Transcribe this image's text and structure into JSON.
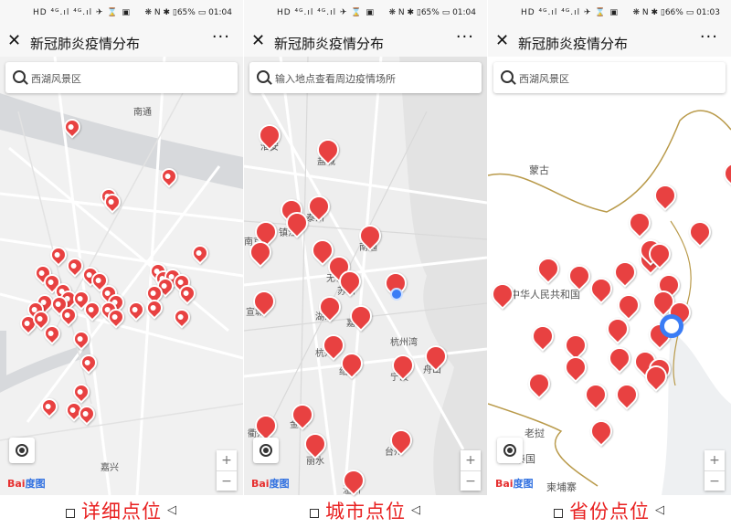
{
  "panels": [
    {
      "status_left": "HD ⁣⁴ᴳ.ıl ⁴ᴳ.ıl ✈ ⌛ ▣",
      "status_right": "❋ N ✱ ▯65% ▭ 01:04",
      "title": "新冠肺炎疫情分布",
      "search_placeholder": "西湖风景区",
      "caption": "详细点位",
      "labels": [
        "南通",
        "嘉兴"
      ]
    },
    {
      "status_left": "HD ⁴ᴳ.ıl ⁴ᴳ.ıl ✈ ⌛ ▣",
      "status_right": "❋ N ✱ ▯65% ▭ 01:04",
      "title": "新冠肺炎疫情分布",
      "search_placeholder": "输入地点查看周边疫情场所",
      "caption": "城市点位",
      "labels": [
        "淮安",
        "盐城",
        "镇江",
        "泰州",
        "南京",
        "南通",
        "无锡",
        "苏州",
        "宣城",
        "湖州",
        "嘉兴",
        "杭州湾",
        "杭州",
        "绍兴",
        "宁波",
        "舟山",
        "金华",
        "衢州",
        "丽水",
        "台州",
        "温州"
      ]
    },
    {
      "status_left": "HD ⁴ᴳ.ıl ⁴ᴳ.ıl ✈ ⌛ ▣",
      "status_right": "❋ N ✱ ▯66% ▭ 01:03",
      "title": "新冠肺炎疫情分布",
      "search_placeholder": "西湖风景区",
      "caption": "省份点位",
      "labels": [
        "蒙古",
        "中华人民共和国",
        "老挝",
        "泰国",
        "柬埔寨"
      ]
    }
  ],
  "brand": {
    "bai": "Bai",
    "du": "度图"
  },
  "colors": {
    "pin": "#e84141",
    "caption": "#e82020",
    "location": "#3a7cf5"
  },
  "icons": {
    "close": "close-icon",
    "more": "more-icon",
    "search": "search-icon",
    "locate": "locate-icon"
  },
  "zoom": {
    "in": "+",
    "out": "−"
  },
  "ui": {
    "close": "✕",
    "more": "···",
    "back": "◁"
  }
}
